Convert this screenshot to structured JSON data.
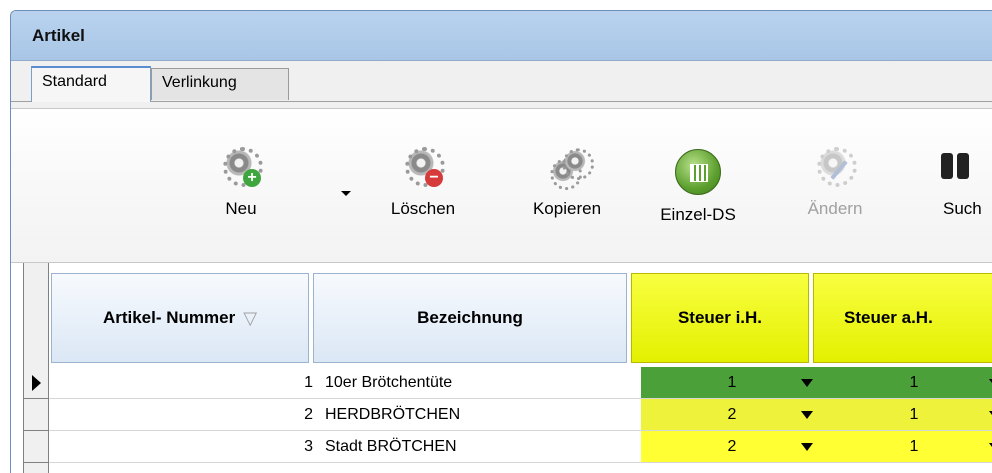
{
  "window": {
    "title": "Artikel"
  },
  "tabs": [
    {
      "label": "Standard",
      "active": true
    },
    {
      "label": "Verlinkung",
      "active": false
    }
  ],
  "toolbar": {
    "buttons": [
      {
        "label": "Neu",
        "icon": "gear-add-icon",
        "enabled": true
      },
      {
        "label": "Löschen",
        "icon": "gear-delete-icon",
        "enabled": true
      },
      {
        "label": "Kopieren",
        "icon": "gears-copy-icon",
        "enabled": true
      },
      {
        "label": "Einzel-DS",
        "icon": "calculator-green-icon",
        "enabled": true
      },
      {
        "label": "Ändern",
        "icon": "gear-edit-icon",
        "enabled": false
      },
      {
        "label": "Such",
        "icon": "binoculars-icon",
        "enabled": true
      }
    ]
  },
  "grid": {
    "columns": [
      {
        "label": "Artikel- Nummer"
      },
      {
        "label": "Bezeichnung"
      },
      {
        "label": "Steuer i.H."
      },
      {
        "label": "Steuer a.H."
      }
    ],
    "rows": [
      {
        "nummer": "1",
        "bezeichnung": "10er Brötchentüte",
        "steuer_ih": "1",
        "steuer_ah": "1",
        "current": true
      },
      {
        "nummer": "2",
        "bezeichnung": "HERDBRÖTCHEN",
        "steuer_ih": "2",
        "steuer_ah": "1",
        "current": false
      },
      {
        "nummer": "3",
        "bezeichnung": "Stadt BRÖTCHEN",
        "steuer_ih": "2",
        "steuer_ah": "1",
        "current": false
      }
    ]
  },
  "colors": {
    "titlebar": "#b9d3ef",
    "highlight_yellow": "#eef23a",
    "selected_green": "#4ba03a"
  }
}
